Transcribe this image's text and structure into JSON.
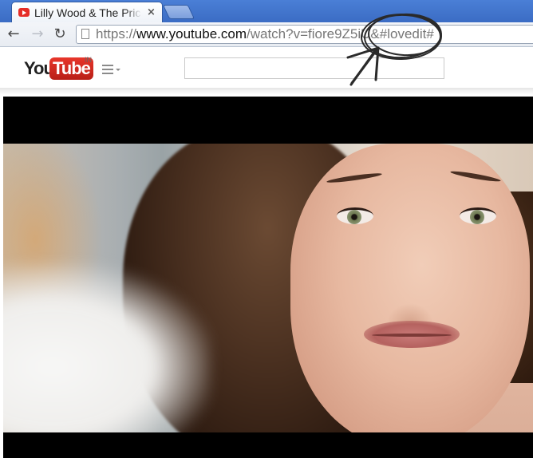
{
  "browser": {
    "tab": {
      "title": "Lilly Wood & The Prick and Robin Schulz - Prayer In C",
      "close_glyph": "×"
    },
    "toolbar": {
      "back_glyph": "←",
      "forward_glyph": "→",
      "reload_glyph": "↻"
    },
    "address_bar": {
      "scheme": "https://",
      "host": "www.youtube.com",
      "path": "/watch?v=fiore9Z5iU",
      "suffix": "&#lovedit#"
    }
  },
  "youtube": {
    "logo": {
      "you": "You",
      "tube": "Tube",
      "country": "IN"
    },
    "search": {
      "placeholder": ""
    }
  },
  "annotation": {
    "color": "#2a2a2a",
    "shape": "hand-drawn-circle-with-arrow"
  },
  "colors": {
    "tab_strip": "#3b6cc4",
    "youtube_red": "#e52d27",
    "player_background": "#000000"
  }
}
